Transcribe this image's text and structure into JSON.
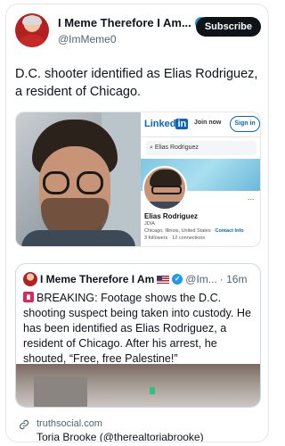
{
  "header": {
    "display_name": "I Meme Therefore I Am...",
    "handle": "@ImMeme0",
    "subscribe_label": "Subscribe",
    "verified_icon": "verified-badge-icon"
  },
  "tweet": {
    "text": "D.C. shooter identified as Elias Rodriguez, a resident of Chicago."
  },
  "linkedin": {
    "logo_text": "Linked",
    "logo_in": "in",
    "join_label": "Join now",
    "sign_label": "Sign in",
    "search_value": "Elias Rodriguez",
    "profile_name": "Elias Rodriguez",
    "company": "JDIA",
    "location": "Chicago, Illinois, United States · ",
    "contact": "Contact Info",
    "followers": "3 followers · 12 connections",
    "more": "..."
  },
  "quote": {
    "name": "I Meme Therefore I Am",
    "handle": "@Im...",
    "time": "· 16m",
    "text": "BREAKING: Footage shows the D.C. shooting suspect being taken into custody. He has been identified as Elias Rodriguez, a resident of Chicago. After his arrest, he shouted, “Free, free Palestine!”"
  },
  "link_card": {
    "domain": "truthsocial.com",
    "title": "Toria Brooke (@therealtoriabrooke)"
  },
  "colors": {
    "accent": "#1d9bf0",
    "linkedin": "#0a66c2",
    "text": "#0f1419",
    "secondary": "#536471"
  }
}
